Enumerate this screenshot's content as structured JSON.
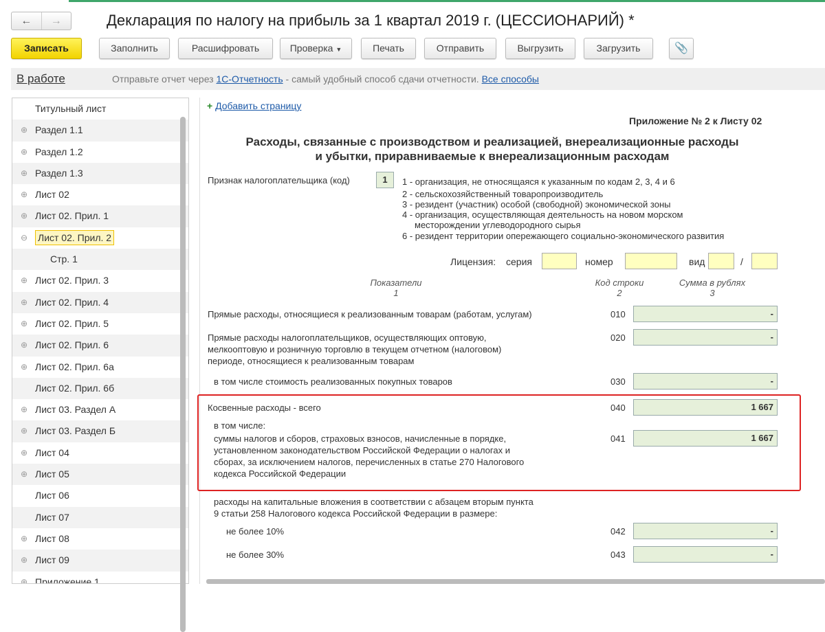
{
  "window": {
    "title": "Декларация по налогу на прибыль за 1 квартал 2019 г. (ЦЕССИОНАРИЙ) *",
    "back": "←",
    "forward": "→"
  },
  "toolbar": {
    "save": "Записать",
    "fill": "Заполнить",
    "decode": "Расшифровать",
    "check": "Проверка",
    "print": "Печать",
    "send": "Отправить",
    "export": "Выгрузить",
    "import": "Загрузить"
  },
  "status": {
    "state": "В работе",
    "msg_pre": "Отправьте отчет через",
    "link1": "1С-Отчетность",
    "msg_mid": "- самый удобный способ сдачи отчетности.",
    "link2": "Все способы"
  },
  "tree": [
    "Титульный лист",
    "Раздел 1.1",
    "Раздел 1.2",
    "Раздел 1.3",
    "Лист 02",
    "Лист 02. Прил. 1",
    "Лист 02. Прил. 2",
    "Стр. 1",
    "Лист 02. Прил. 3",
    "Лист 02. Прил. 4",
    "Лист 02. Прил. 5",
    "Лист 02. Прил. 6",
    "Лист 02. Прил. 6а",
    "Лист 02. Прил. 6б",
    "Лист 03. Раздел А",
    "Лист 03. Раздел Б",
    "Лист 04",
    "Лист 05",
    "Лист 06",
    "Лист 07",
    "Лист 08",
    "Лист 09",
    "Приложение 1"
  ],
  "form": {
    "add_page": "Добавить страницу",
    "appendix": "Приложение № 2 к Листу 02",
    "heading1": "Расходы, связанные с производством и реализацией, внереализационные расходы",
    "heading2": "и убытки, приравниваемые к внереализационным расходам",
    "taxpayer_label": "Признак налогоплательщика (код)",
    "taxpayer_code": "1",
    "codes": [
      "1 - организация, не относящаяся к указанным по кодам 2, 3, 4 и 6",
      "2 - сельскохозяйственный товаропроизводитель",
      "3 - резидент (участник) особой (свободной) экономической зоны",
      "4 - организация, осуществляющая деятельность на новом морском",
      "месторождении углеводородного сырья",
      "6 - резидент территории опережающего социально-экономического развития"
    ],
    "license": {
      "label": "Лицензия:",
      "series": "серия",
      "number": "номер",
      "type": "вид",
      "slash": "/"
    },
    "cols": {
      "c1": "Показатели",
      "c1n": "1",
      "c2": "Код строки",
      "c2n": "2",
      "c3": "Сумма в рублях",
      "c3n": "3"
    },
    "rows": [
      {
        "text": "Прямые расходы, относящиеся к реализованным товарам (работам, услугам)",
        "code": "010",
        "value": "-"
      },
      {
        "text": "Прямые расходы налогоплательщиков, осуществляющих оптовую,|мелкооптовую и розничную торговлю в текущем отчетном (налоговом)|периоде, относящиеся к реализованным товарам",
        "code": "020",
        "value": "-"
      },
      {
        "text": "в том числе стоимость реализованных покупных товаров",
        "code": "030",
        "value": "-"
      },
      {
        "text": "Косвенные расходы - всего",
        "code": "040",
        "value": "1 667"
      },
      {
        "text": "в том числе:"
      },
      {
        "text": "суммы налогов и сборов, страховых взносов, начисленные в порядке,|установленном законодательством Российской Федерации о налогах и|сборах, за исключением налогов, перечисленных в статье 270 Налогового|кодекса Российской Федерации",
        "code": "041",
        "value": "1 667"
      },
      {
        "text": "расходы на капитальные вложения в соответствии с абзацем вторым пункта|9 статьи 258 Налогового кодекса Российской Федерации в размере:"
      },
      {
        "text": "не более 10%",
        "code": "042",
        "value": "-"
      },
      {
        "text": "не более 30%",
        "code": "043",
        "value": "-"
      }
    ]
  }
}
